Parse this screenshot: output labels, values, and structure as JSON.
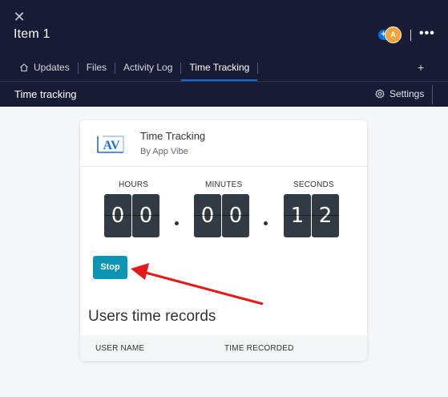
{
  "window": {
    "close_glyph": "✕",
    "item_title": "Item 1",
    "avatar_plus": "+",
    "avatar_initial": "A",
    "more_glyph": "•••"
  },
  "tabs": [
    {
      "label": "Updates",
      "icon": "home-icon"
    },
    {
      "label": "Files"
    },
    {
      "label": "Activity Log"
    },
    {
      "label": "Time Tracking",
      "active": true
    }
  ],
  "add_tab_glyph": "+",
  "subbar": {
    "title": "Time tracking",
    "settings_label": "Settings"
  },
  "app": {
    "logo_text": "AV",
    "name": "Time Tracking",
    "by": "By App Vibe"
  },
  "timer": {
    "hours_label": "HOURS",
    "minutes_label": "MINUTES",
    "seconds_label": "SECONDS",
    "hours": [
      "0",
      "0"
    ],
    "minutes": [
      "0",
      "0"
    ],
    "seconds": [
      "1",
      "2"
    ]
  },
  "stop_label": "Stop",
  "records": {
    "title": "Users time records",
    "columns": [
      "USER NAME",
      "TIME RECORDED"
    ]
  },
  "colors": {
    "topbar": "#181b34",
    "tab_active_underline": "#0073ea",
    "stop_button": "#0b95b3",
    "digit_tile": "#323a44",
    "annotation_arrow": "#e21a1a",
    "logo_blue": "#1e6fd0"
  }
}
